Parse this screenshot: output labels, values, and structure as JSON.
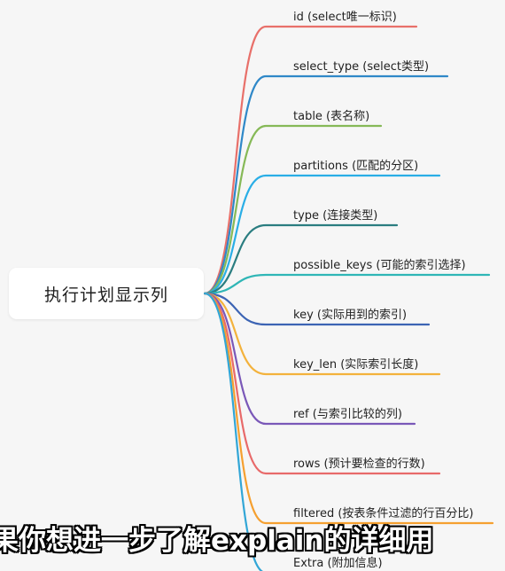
{
  "root": {
    "label": "执行计划显示列"
  },
  "nodes": [
    {
      "label": "id (select唯一标识)",
      "color": "#e8706a"
    },
    {
      "label": "select_type (select类型)",
      "color": "#2f88c8"
    },
    {
      "label": "table (表名称)",
      "color": "#86b957"
    },
    {
      "label": "partitions (匹配的分区)",
      "color": "#2aaee6"
    },
    {
      "label": "type (连接类型)",
      "color": "#2a7d80"
    },
    {
      "label": "possible_keys (可能的索引选择)",
      "color": "#2fb6b6"
    },
    {
      "label": "key (实际用到的索引)",
      "color": "#3c64b4"
    },
    {
      "label": "key_len (实际索引长度)",
      "color": "#f3b23c"
    },
    {
      "label": "ref (与索引比较的列)",
      "color": "#7a58b8"
    },
    {
      "label": "rows (预计要检查的行数)",
      "color": "#e86a6a"
    },
    {
      "label": "filtered (按表条件过滤的行百分比)",
      "color": "#f5a030"
    },
    {
      "label": "Extra (附加信息)",
      "color": "#32a6d6"
    }
  ],
  "subtitle": {
    "text": "果你想进一步了解explain的详细用"
  }
}
